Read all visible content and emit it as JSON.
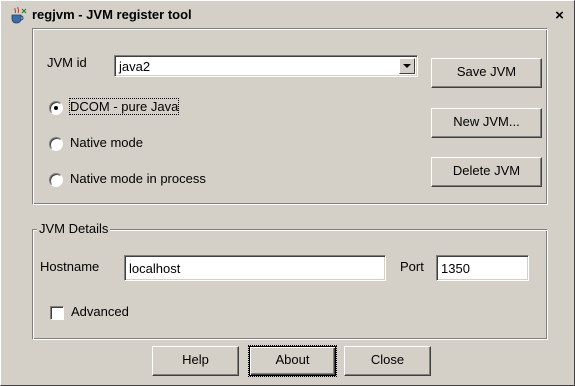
{
  "window": {
    "title": "regjvm - JVM register tool",
    "close_glyph": "×",
    "icon": "java-cup-icon"
  },
  "jvm": {
    "id_label": "JVM id",
    "id_value": "java2",
    "save_label": "Save JVM",
    "new_label": "New JVM...",
    "delete_label": "Delete JVM"
  },
  "modes": [
    {
      "label": "DCOM - pure Java",
      "checked": true
    },
    {
      "label": "Native mode",
      "checked": false
    },
    {
      "label": "Native mode in process",
      "checked": false
    }
  ],
  "details": {
    "group_label": "JVM Details",
    "hostname_label": "Hostname",
    "hostname_value": "localhost",
    "port_label": "Port",
    "port_value": "1350",
    "advanced_label": "Advanced",
    "advanced_checked": false
  },
  "footer": {
    "help_label": "Help",
    "about_label": "About",
    "close_label": "Close"
  }
}
